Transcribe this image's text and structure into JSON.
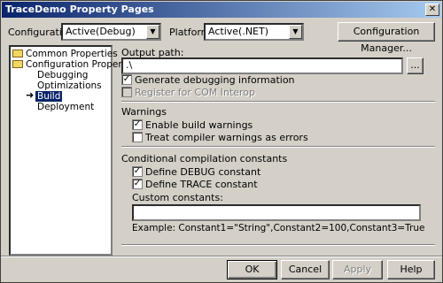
{
  "window": {
    "title": "TraceDemo Property Pages",
    "close_glyph": "✕"
  },
  "toolbar": {
    "configuration_label": "Configuration:",
    "configuration_value": "Active(Debug)",
    "platform_label": "Platform:",
    "platform_value": "Active(.NET)",
    "config_manager_label": "Configuration Manager..."
  },
  "tree": {
    "items": [
      {
        "label": "Common Properties",
        "type": "folder"
      },
      {
        "label": "Configuration Properties",
        "type": "folder"
      },
      {
        "label": "Debugging",
        "type": "leaf"
      },
      {
        "label": "Optimizations",
        "type": "leaf"
      },
      {
        "label": "Build",
        "type": "leaf",
        "selected": true
      },
      {
        "label": "Deployment",
        "type": "leaf"
      }
    ]
  },
  "build": {
    "output_path_label": "Output path:",
    "output_path_value": ".\\",
    "browse_label": "...",
    "generate_debug_label": "Generate debugging information",
    "generate_debug_checked": true,
    "register_com_label": "Register for COM Interop",
    "register_com_checked": false,
    "warnings_heading": "Warnings",
    "enable_warnings_label": "Enable build warnings",
    "enable_warnings_checked": true,
    "treat_warnings_label": "Treat compiler warnings as errors",
    "treat_warnings_checked": false,
    "conditional_heading": "Conditional compilation constants",
    "define_debug_label": "Define DEBUG constant",
    "define_debug_checked": true,
    "define_trace_label": "Define TRACE constant",
    "define_trace_checked": true,
    "custom_constants_label": "Custom constants:",
    "custom_constants_value": "",
    "example_text": "Example: Constant1=\"String\",Constant2=100,Constant3=True"
  },
  "buttons": {
    "ok": "OK",
    "cancel": "Cancel",
    "apply": "Apply",
    "help": "Help"
  },
  "check_glyph": "✓"
}
